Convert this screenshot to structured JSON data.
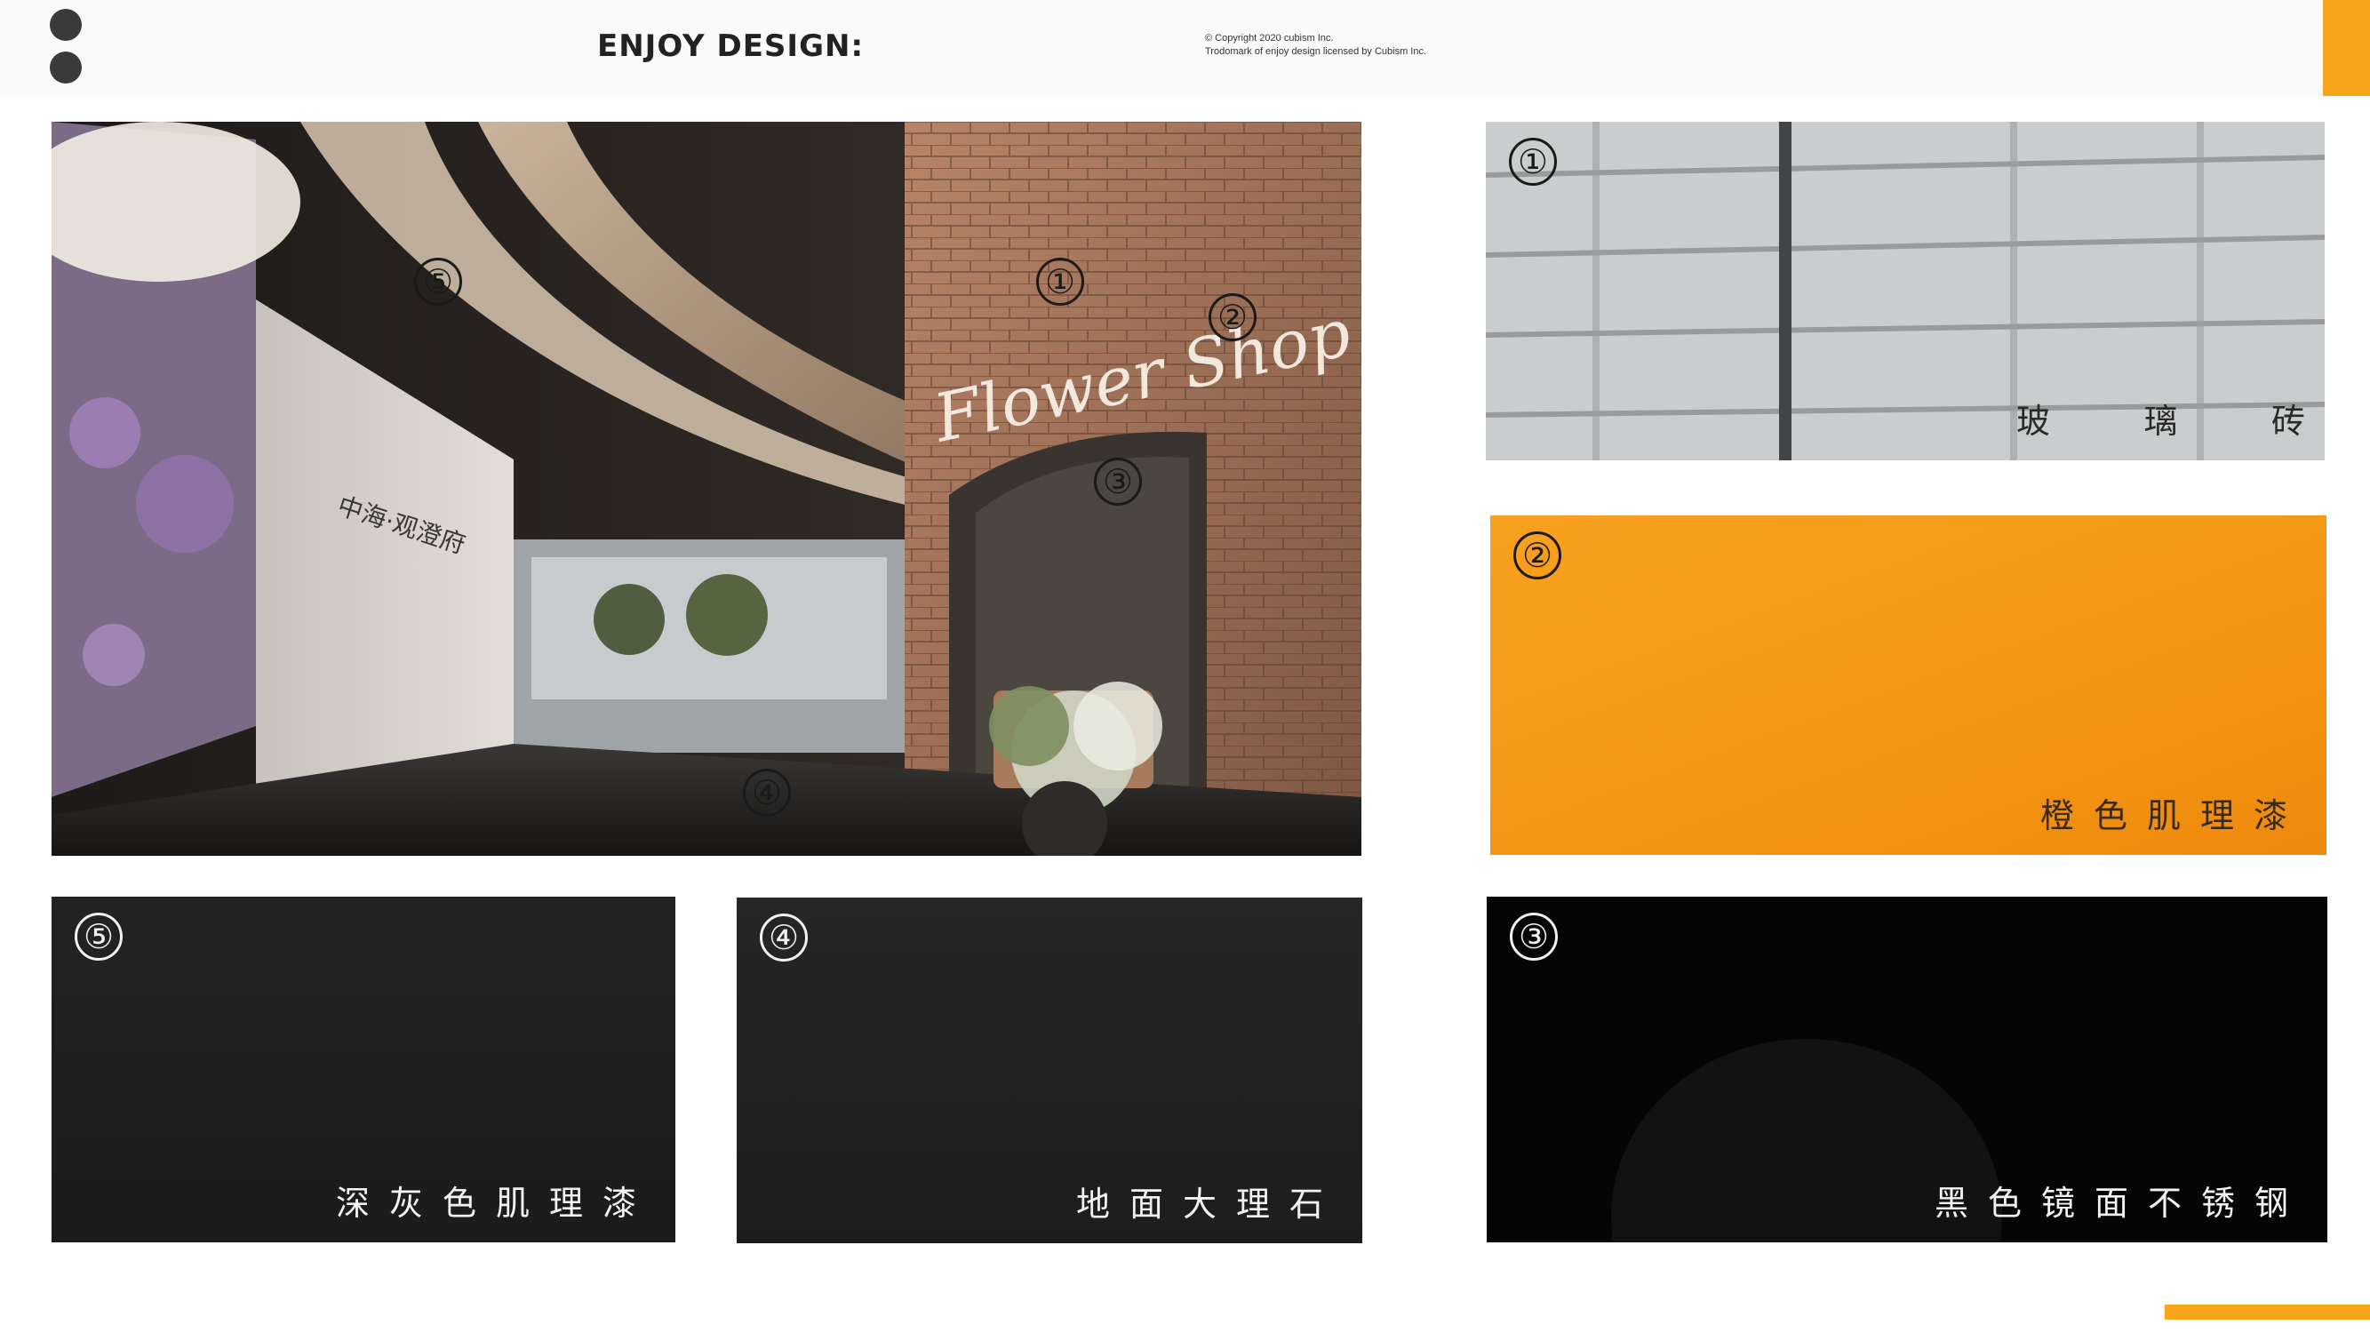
{
  "header": {
    "brand": "ENJOY DESIGN",
    "brand_mark": ":",
    "copyright_line1": "©     Copyright 2020  cubism Inc.",
    "copyright_line2": "Trodomark of  enjoy  design  licensed  by Cubism Inc."
  },
  "scene": {
    "callouts": [
      "⑤",
      "①",
      "②",
      "③",
      "④"
    ],
    "sign_text": "Flower Shop",
    "wall_text": "中海·观澄府"
  },
  "swatches": [
    {
      "num": "①",
      "label": "玻璃砖",
      "chars": [
        "玻",
        "璃",
        "砖"
      ]
    },
    {
      "num": "②",
      "label": "橙色肌理漆"
    },
    {
      "num": "③",
      "label": "黑色镜面不锈钢"
    },
    {
      "num": "⑤",
      "label": "深灰色肌理漆"
    },
    {
      "num": "④",
      "label": "地面大理石"
    }
  ],
  "colors": {
    "accent": "#f7a51a",
    "orange_swatch": "#f59a16",
    "dark_swatch": "#1f1f1f",
    "black_swatch": "#050505"
  }
}
